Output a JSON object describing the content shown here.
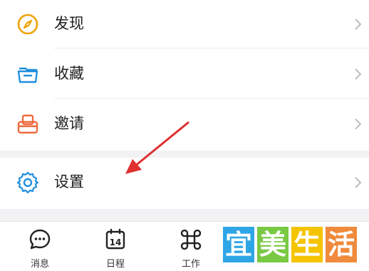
{
  "menu": {
    "items": [
      {
        "label": "发现",
        "icon": "compass-icon",
        "color": "#f0a20a"
      },
      {
        "label": "收藏",
        "icon": "folder-icon",
        "color": "#1f8fde"
      },
      {
        "label": "邀请",
        "icon": "invite-icon",
        "color": "#ef6a3e"
      }
    ],
    "settings": {
      "label": "设置",
      "icon": "gear-icon",
      "color": "#1f8fde"
    }
  },
  "tabbar": {
    "tabs": [
      {
        "label": "消息",
        "icon": "chat-icon"
      },
      {
        "label": "日程",
        "icon": "calendar-icon",
        "day": "14"
      },
      {
        "label": "工作",
        "icon": "grid-icon"
      }
    ]
  },
  "annotation": {
    "arrow_color": "#e03030"
  },
  "watermark": {
    "chars": [
      "宜",
      "美",
      "生",
      "活"
    ],
    "colors": [
      "#2ea6e6",
      "#7ac943",
      "#f5c400",
      "#f08a3c"
    ]
  }
}
